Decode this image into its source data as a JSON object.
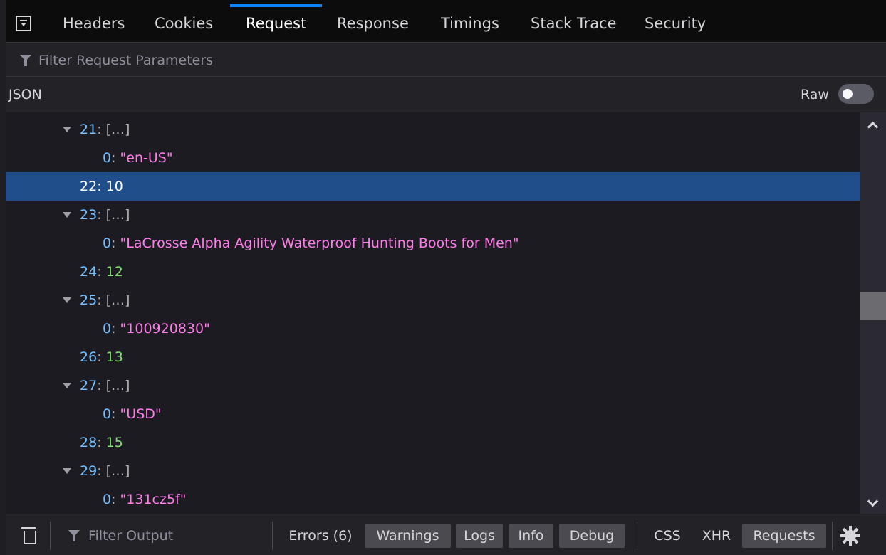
{
  "tabs": [
    {
      "label": "Headers"
    },
    {
      "label": "Cookies"
    },
    {
      "label": "Request",
      "active": true
    },
    {
      "label": "Response"
    },
    {
      "label": "Timings"
    },
    {
      "label": "Stack Trace"
    },
    {
      "label": "Security"
    }
  ],
  "filter": {
    "placeholder": "Filter Request Parameters"
  },
  "json_header": {
    "title": "JSON",
    "raw_label": "Raw",
    "raw_enabled": false
  },
  "tree": [
    {
      "key": "21",
      "value": "[…]",
      "kind": "array",
      "expanded": true
    },
    {
      "key": "0",
      "value": "\"en-US\"",
      "kind": "string",
      "child": true
    },
    {
      "key": "22",
      "value": "10",
      "kind": "number",
      "selected": true
    },
    {
      "key": "23",
      "value": "[…]",
      "kind": "array",
      "expanded": true
    },
    {
      "key": "0",
      "value": "\"LaCrosse Alpha Agility Waterproof Hunting Boots for Men\"",
      "kind": "string",
      "child": true
    },
    {
      "key": "24",
      "value": "12",
      "kind": "number"
    },
    {
      "key": "25",
      "value": "[…]",
      "kind": "array",
      "expanded": true
    },
    {
      "key": "0",
      "value": "\"100920830\"",
      "kind": "string",
      "child": true
    },
    {
      "key": "26",
      "value": "13",
      "kind": "number"
    },
    {
      "key": "27",
      "value": "[…]",
      "kind": "array",
      "expanded": true
    },
    {
      "key": "0",
      "value": "\"USD\"",
      "kind": "string",
      "child": true
    },
    {
      "key": "28",
      "value": "15",
      "kind": "number"
    },
    {
      "key": "29",
      "value": "[…]",
      "kind": "array",
      "expanded": true
    },
    {
      "key": "0",
      "value": "\"131cz5f\"",
      "kind": "string",
      "child": true
    }
  ],
  "toolbar": {
    "output_filter_placeholder": "Filter Output",
    "buttons": [
      {
        "label": "Errors (6)",
        "on": false
      },
      {
        "label": "Warnings",
        "on": true
      },
      {
        "label": "Logs",
        "on": true
      },
      {
        "label": "Info",
        "on": true
      },
      {
        "label": "Debug",
        "on": true
      },
      {
        "label": "CSS",
        "on": false
      },
      {
        "label": "XHR",
        "on": false
      },
      {
        "label": "Requests",
        "on": true
      }
    ]
  },
  "colors": {
    "accent": "#0a84ff",
    "selection": "#204e8a",
    "key": "#75bfff",
    "string": "#ff7de9",
    "number": "#86de74"
  },
  "icons": {
    "panel_toggle": "dock-toggle-icon",
    "filter": "funnel-icon",
    "trash": "trash-icon",
    "settings": "gear-icon"
  }
}
